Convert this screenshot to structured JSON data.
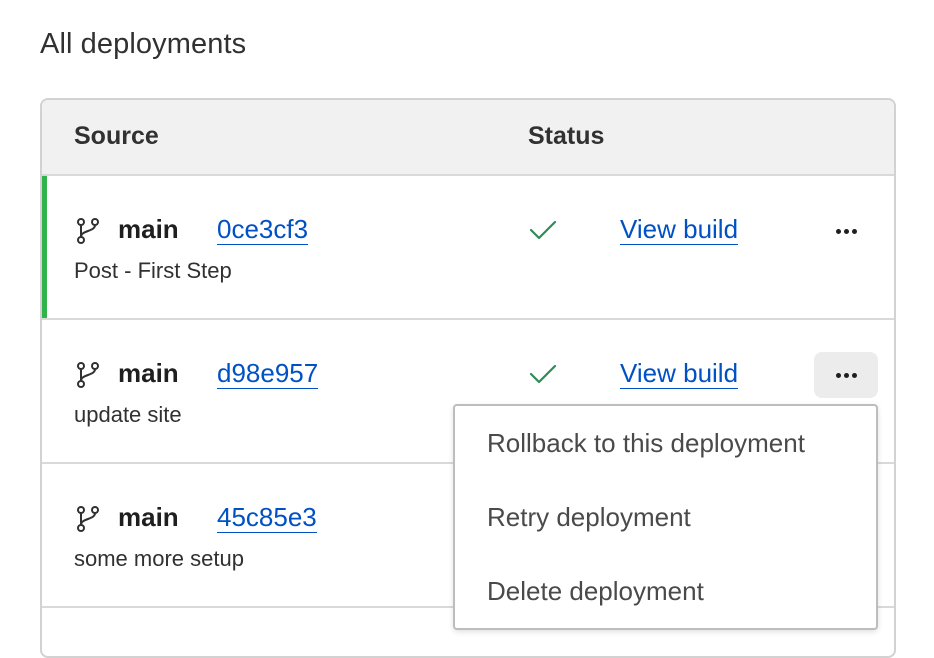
{
  "page": {
    "title": "All deployments"
  },
  "table": {
    "headers": {
      "source": "Source",
      "status": "Status"
    },
    "rows": [
      {
        "branch": "main",
        "commit": "0ce3cf3",
        "message": "Post - First Step",
        "status": "success",
        "action": "View build",
        "active": true
      },
      {
        "branch": "main",
        "commit": "d98e957",
        "message": "update site",
        "status": "success",
        "action": "View build",
        "active": false
      },
      {
        "branch": "main",
        "commit": "45c85e3",
        "message": "some more setup",
        "status": "",
        "action": "",
        "active": false
      }
    ]
  },
  "menu": {
    "items": [
      "Rollback to this deployment",
      "Retry deployment",
      "Delete deployment"
    ]
  },
  "colors": {
    "accent": "#0051c3",
    "success": "#2fb34a",
    "active_bar": "#2fb34a"
  },
  "icons": {
    "branch": "git-branch-icon",
    "check": "check-icon",
    "more": "more-horizontal-icon"
  }
}
